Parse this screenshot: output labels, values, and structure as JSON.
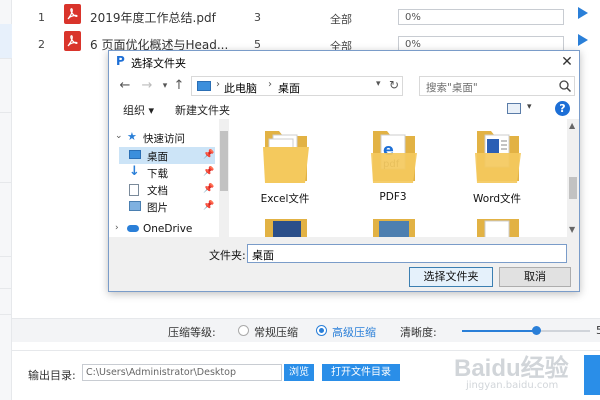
{
  "files": [
    {
      "index": "1",
      "name": "2019年度工作总结.pdf",
      "pages": "3",
      "range": "全部",
      "progress_text": "0%",
      "progress": 0
    },
    {
      "index": "2",
      "name": "6 页面优化概述与Head...",
      "pages": "5",
      "range": "全部",
      "progress_text": "0%",
      "progress": 0
    }
  ],
  "dialog": {
    "title": "选择文件夹",
    "breadcrumb": [
      "此电脑",
      "桌面"
    ],
    "search_placeholder": "搜索\"桌面\"",
    "toolbar": {
      "organize": "组织 ▾",
      "new_folder": "新建文件夹"
    },
    "nav": [
      {
        "label": "快速访问",
        "icon": "star-icon"
      },
      {
        "label": "桌面",
        "icon": "desktop-icon",
        "selected": true
      },
      {
        "label": "下载",
        "icon": "download-icon"
      },
      {
        "label": "文档",
        "icon": "document-icon"
      },
      {
        "label": "图片",
        "icon": "picture-icon"
      },
      {
        "label": "OneDrive",
        "icon": "cloud-icon"
      }
    ],
    "folders": [
      "Excel文件",
      "PDF3",
      "Word文件"
    ],
    "folder_label": "文件夹:",
    "folder_value": "桌面",
    "select_button": "选择文件夹",
    "cancel_button": "取消"
  },
  "compression": {
    "level_label": "压缩等级:",
    "options": [
      "常规压缩",
      "高级压缩"
    ],
    "selected": "高级压缩",
    "clarity_label": "清晰度:",
    "clarity_value": "5",
    "slider_fraction": 0.58
  },
  "output": {
    "label": "输出目录:",
    "path": "C:\\Users\\Administrator\\Desktop",
    "browse_button": "浏览",
    "open_button": "打开文件目录"
  },
  "watermark": {
    "main": "Baidu经验",
    "sub": "jingyan.baidu.com"
  },
  "colors": {
    "accent": "#2a8ee8",
    "pdf_red": "#d9342b",
    "folder_yellow": "#f4c95d"
  }
}
